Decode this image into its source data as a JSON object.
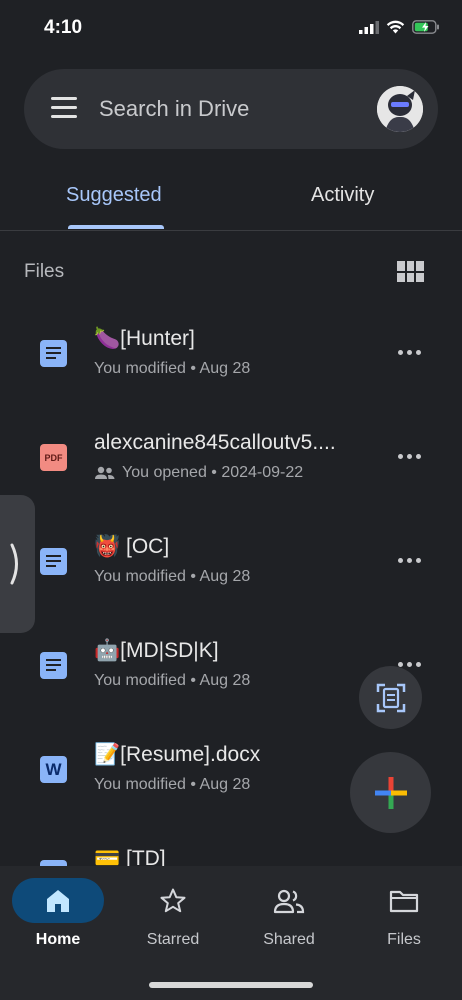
{
  "status_bar": {
    "time": "4:10"
  },
  "search": {
    "placeholder": "Search in Drive"
  },
  "tabs": [
    {
      "label": "Suggested",
      "selected": true
    },
    {
      "label": "Activity",
      "selected": false
    }
  ],
  "files_section": {
    "label": "Files"
  },
  "files": [
    {
      "title": "🍆[Hunter]",
      "meta": "You modified • Aug 28",
      "type": "doc",
      "shared": false
    },
    {
      "title": "alexcanine845calloutv5....",
      "meta": "You opened • 2024-09-22",
      "type": "pdf",
      "shared": true
    },
    {
      "title": "👹 [OC]",
      "meta": "You modified • Aug 28",
      "type": "doc",
      "shared": false
    },
    {
      "title": "🤖[MD|SD|K]",
      "meta": "You modified • Aug 28",
      "type": "doc",
      "shared": false
    },
    {
      "title": "📝[Resume].docx",
      "meta": "You modified • Aug 28",
      "type": "word",
      "shared": false
    },
    {
      "title": "💳 [TD]",
      "meta": "",
      "type": "doc",
      "shared": false
    }
  ],
  "icons": {
    "pdf_text": "PDF",
    "word_text": "W"
  },
  "bottom_nav": [
    {
      "label": "Home",
      "icon": "home-icon",
      "active": true
    },
    {
      "label": "Starred",
      "icon": "star-icon",
      "active": false
    },
    {
      "label": "Shared",
      "icon": "people-icon",
      "active": false
    },
    {
      "label": "Files",
      "icon": "folder-icon",
      "active": false
    }
  ],
  "colors": {
    "accent": "#a8c7fa",
    "background": "#1f2125",
    "nav_active": "#0e4a79"
  }
}
